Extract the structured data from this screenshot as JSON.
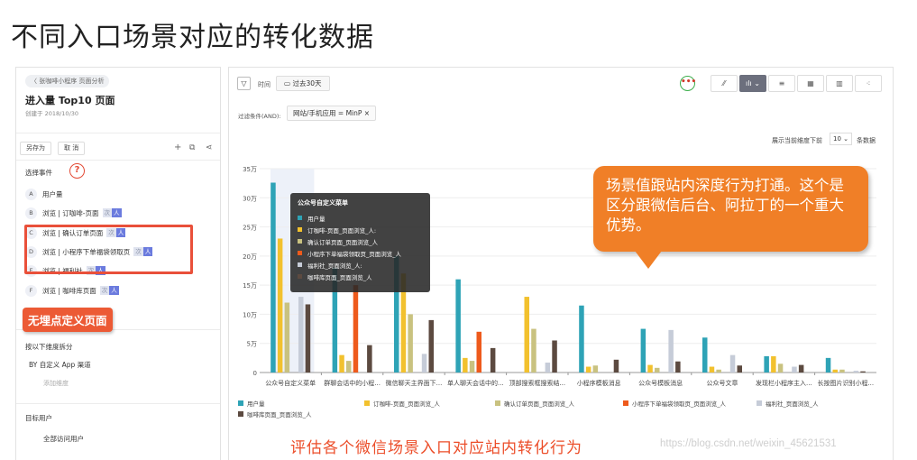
{
  "slide_title": "不同入口场景对应的转化数据",
  "left_panel": {
    "back_link": "〈 张咖啡小程序 页面分析",
    "heading": "进入量 Top10 页面",
    "created": "创建于 2018/10/30",
    "save_as": "另存为",
    "cancel": "取 消",
    "add_icon": "+",
    "copy_icon": "⧉",
    "share_icon": "⋖",
    "select_events_label": "选择事件",
    "help_icon": "?",
    "events": [
      {
        "letter": "A",
        "label": "用户量",
        "tag1": "",
        "tag2": ""
      },
      {
        "letter": "B",
        "label": "浏览 | 订咖啡-页面",
        "tag1": "次",
        "tag2": "人"
      },
      {
        "letter": "C",
        "label": "浏览 | 确认订单页面",
        "tag1": "次",
        "tag2": "人"
      },
      {
        "letter": "D",
        "label": "浏览 | 小程序下单福袋领取页",
        "tag1": "次",
        "tag2": "人"
      },
      {
        "letter": "E",
        "label": "浏览 | 福利社",
        "tag1": "次",
        "tag2": "人"
      },
      {
        "letter": "F",
        "label": "浏览 | 咖啡库页面",
        "tag1": "次",
        "tag2": "人"
      }
    ],
    "callout": "无埋点定义页面",
    "split_label": "按以下维度拆分",
    "split_item": "BY 自定义 App 渠道",
    "add_dimension": "添加维度",
    "target_users_label": "目标用户",
    "target_user_item": "全部访问用户"
  },
  "toolbar": {
    "filter_icon": "▽",
    "time_label": "时间",
    "time_range": "▭  过去30天",
    "more_icon": "•••",
    "view_icons": [
      "⁄⁄",
      "ılı ⌄",
      "≡",
      "▦",
      "▥",
      "⁖"
    ],
    "filter_label": "过滤条件(AND):",
    "filter_chip": "网站/手机应用 = MinP  ×",
    "top_n_label": "展示当前维度下前",
    "top_n_value": "10 ⌄",
    "top_n_suffix": "条数据"
  },
  "tooltip": {
    "title": "公众号自定义菜单",
    "rows": [
      {
        "label": "用户量",
        "color": "#2ea3b6"
      },
      {
        "label": "订咖啡-页面_页面浏览_人:",
        "color": "#f2c12e"
      },
      {
        "label": "确认订单页面_页面浏览_人",
        "color": "#c9c280"
      },
      {
        "label": "小程序下单福袋领取页_页面浏览_人",
        "color": "#ee5a1c"
      },
      {
        "label": "福利社_页面浏览_人:",
        "color": "#c6ccd8"
      },
      {
        "label": "咖啡库页面_页面浏览_人",
        "color": "#5c4a40"
      }
    ]
  },
  "callout_orange": "场景值跟站内深度行为打通。这个是区分跟微信后台、阿拉丁的一个重大优势。",
  "bottom_caption": "评估各个微信场景入口对应站内转化行为",
  "watermark": "https://blog.csdn.net/weixin_45621531",
  "chart_data": {
    "type": "bar",
    "ylim": [
      0,
      350000
    ],
    "y_ticks": [
      "0",
      "5万",
      "10万",
      "15万",
      "20万",
      "25万",
      "30万",
      "35万"
    ],
    "y_tick_values": [
      0,
      50000,
      100000,
      150000,
      200000,
      250000,
      300000,
      350000
    ],
    "categories": [
      "公众号自定义菜单",
      "群聊会话中的小程...",
      "微信聊天主界面下...",
      "单人聊天会话中的...",
      "顶部搜索框搜索结...",
      "小程序模板消息",
      "公众号模板消息",
      "公众号文章",
      "发现栏小程序主入...",
      "长按图片识别小程..."
    ],
    "series": [
      {
        "name": "用户量",
        "color": "#2ea3b6",
        "values": [
          326000,
          180000,
          200000,
          160000,
          0,
          115000,
          75000,
          60000,
          28000,
          25000
        ]
      },
      {
        "name": "订咖啡-页面_页面浏览_人",
        "color": "#f2c12e",
        "values": [
          230000,
          30000,
          170000,
          25000,
          130000,
          10000,
          13000,
          10000,
          28000,
          5000
        ]
      },
      {
        "name": "确认订单页面_页面浏览_人",
        "color": "#c9c280",
        "values": [
          120000,
          20000,
          100000,
          20000,
          75000,
          12000,
          8000,
          5000,
          15000,
          5000
        ]
      },
      {
        "name": "小程序下单福袋领取页_页面浏览_人",
        "color": "#ee5a1c",
        "values": [
          0,
          150000,
          0,
          70000,
          0,
          0,
          0,
          0,
          0,
          0
        ]
      },
      {
        "name": "福利社_页面浏览_人",
        "color": "#c6ccd8",
        "values": [
          130000,
          0,
          32000,
          0,
          17000,
          0,
          73000,
          30000,
          10000,
          3000
        ]
      },
      {
        "name": "咖啡库页面_页面浏览_人",
        "color": "#5c4a40",
        "values": [
          117000,
          47000,
          90000,
          42000,
          55000,
          22000,
          19000,
          12000,
          13000,
          2000
        ]
      }
    ]
  },
  "legend": [
    {
      "name": "用户量",
      "color": "#2ea3b6"
    },
    {
      "name": "订咖啡-页面_页面浏览_人",
      "color": "#f2c12e"
    },
    {
      "name": "确认订单页面_页面浏览_人",
      "color": "#c9c280"
    },
    {
      "name": "小程序下单福袋领取页_页面浏览_人",
      "color": "#ee5a1c"
    },
    {
      "name": "福利社_页面浏览_人",
      "color": "#c6ccd8"
    },
    {
      "name": "咖啡库页面_页面浏览_人",
      "color": "#5c4a40"
    }
  ]
}
